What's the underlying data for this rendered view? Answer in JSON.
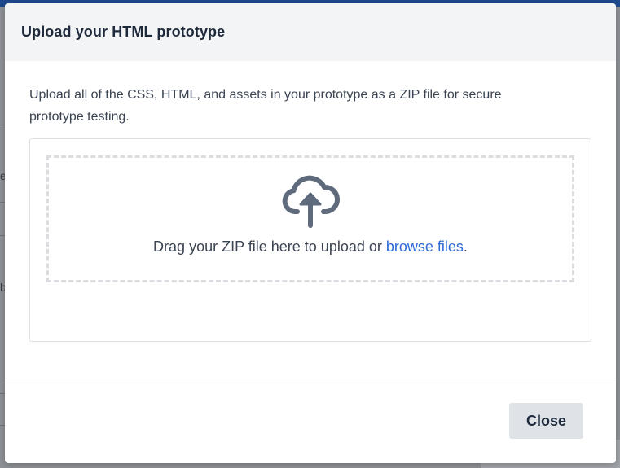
{
  "modal": {
    "title": "Upload your HTML prototype",
    "description": "Upload all of the CSS, HTML, and assets in your prototype as a ZIP file for secure prototype testing.",
    "dropzone": {
      "icon": "cloud-upload-icon",
      "text_before": "Drag your ZIP file here to upload or ",
      "link_label": "browse files",
      "text_after": "."
    },
    "close_label": "Close"
  },
  "background": {
    "glyph_1": "e",
    "glyph_2": "b"
  },
  "colors": {
    "accent_link": "#2f6bd8",
    "title_text": "#1e2a3b",
    "body_text": "#3b4452",
    "icon": "#5f6b7c",
    "header_bg": "#f3f4f6",
    "button_bg": "#dfe2e7",
    "top_bar": "#1f4a8f"
  }
}
